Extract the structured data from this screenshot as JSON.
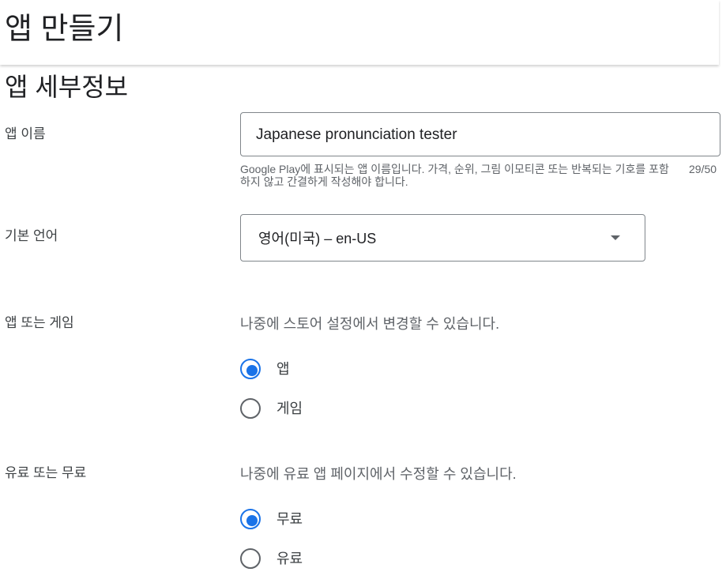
{
  "header": {
    "title": "앱 만들기"
  },
  "section": {
    "title": "앱 세부정보"
  },
  "app_name": {
    "label": "앱 이름",
    "value": "Japanese pronunciation tester",
    "helper": "Google Play에 표시되는 앱 이름입니다. 가격, 순위, 그림 이모티콘 또는 반복되는 기호를 포함하지 않고 간결하게 작성해야 합니다.",
    "counter": "29/50"
  },
  "default_language": {
    "label": "기본 언어",
    "value": "영어(미국) – en-US"
  },
  "app_or_game": {
    "label": "앱 또는 게임",
    "hint": "나중에 스토어 설정에서 변경할 수 있습니다.",
    "options": [
      {
        "label": "앱",
        "selected": true
      },
      {
        "label": "게임",
        "selected": false
      }
    ]
  },
  "free_or_paid": {
    "label": "유료 또는 무료",
    "hint": "나중에 유료 앱 페이지에서 수정할 수 있습니다.",
    "options": [
      {
        "label": "무료",
        "selected": true
      },
      {
        "label": "유료",
        "selected": false
      }
    ]
  },
  "colors": {
    "accent": "#1a73e8",
    "border": "#80868b",
    "text_secondary": "#5f6368"
  }
}
